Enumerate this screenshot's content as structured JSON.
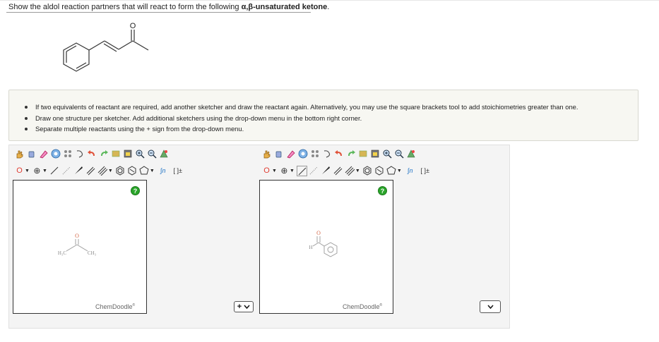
{
  "question": {
    "text_prefix": "Show the aldol reaction partners that will react to form the following ",
    "text_bold": "α,β-unsaturated ketone",
    "text_suffix": "."
  },
  "target_molecule": {
    "atom_label": "O"
  },
  "instructions": [
    "If two equivalents of reactant are required, add another sketcher and draw the reactant again. Alternatively, you may use the square brackets tool to add stoichiometries greater than one.",
    "Draw one structure per sketcher. Add additional sketchers using the drop-down menu in the bottom right corner.",
    "Separate multiple reactants using the + sign from the drop-down menu."
  ],
  "sketchers": [
    {
      "toolbar": {
        "atom_label": "O",
        "charge_label": "⊕",
        "sn_label": "∫n",
        "brackets_label": "[ ]±"
      },
      "help_label": "?",
      "molecule_labels": {
        "left": "H₃C",
        "right": "CH₃",
        "oxygen": "O"
      },
      "brand": "ChemDoodle",
      "brand_mark": "®"
    },
    {
      "toolbar": {
        "atom_label": "O",
        "charge_label": "⊕",
        "sn_label": "∫n",
        "brackets_label": "[ ]±"
      },
      "help_label": "?",
      "molecule_labels": {
        "h": "H",
        "oxygen": "O"
      },
      "brand": "ChemDoodle",
      "brand_mark": "®"
    }
  ],
  "separator_select": {
    "value": "+"
  },
  "colors": {
    "accent_green": "#2aa52a",
    "panel_bg": "#f7f7f2",
    "oxygen_red": "#e03c31"
  }
}
